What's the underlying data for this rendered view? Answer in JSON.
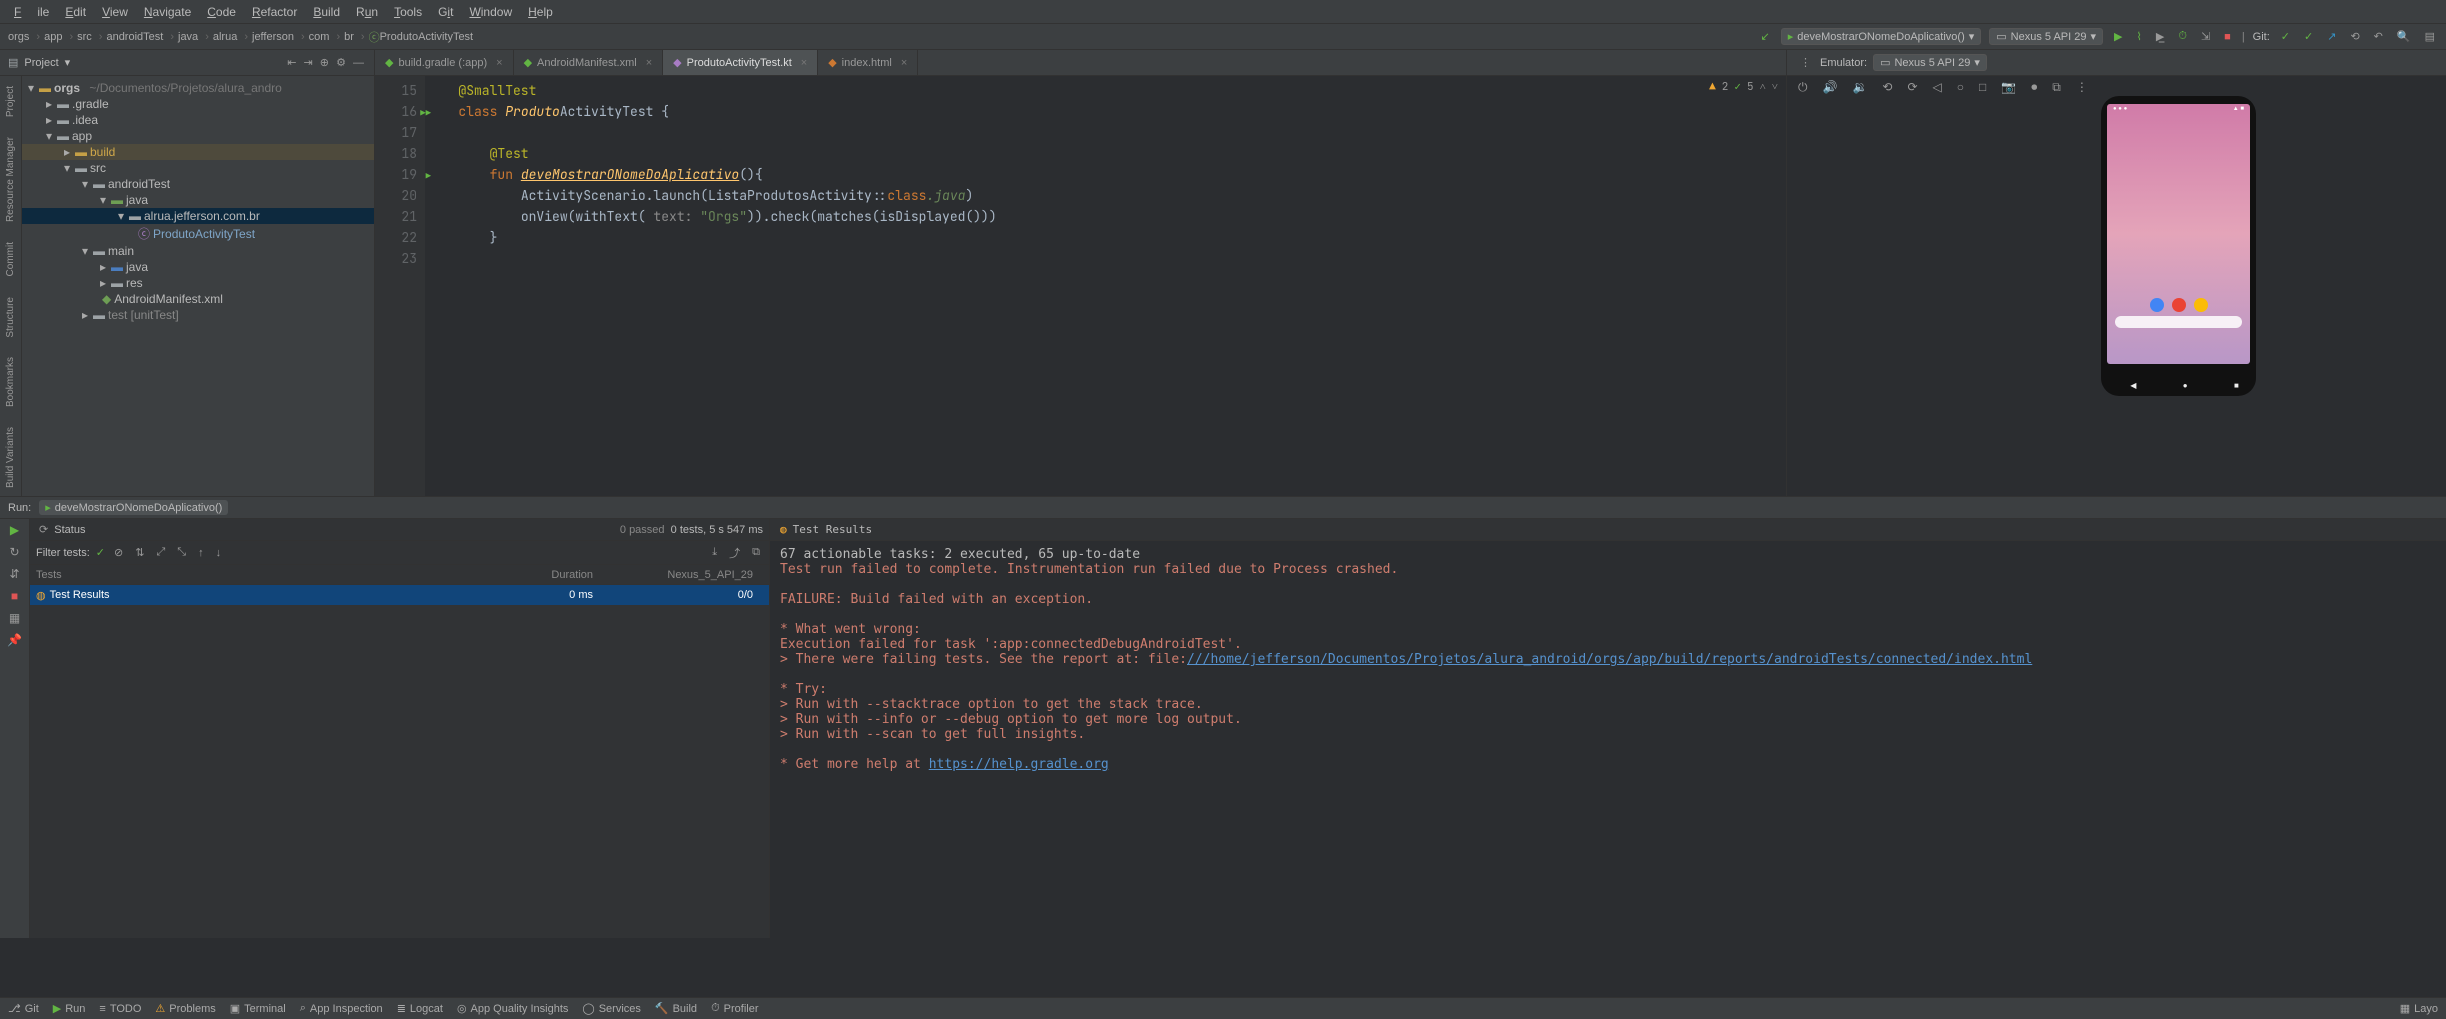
{
  "menu": {
    "file": "File",
    "edit": "Edit",
    "view": "View",
    "navigate": "Navigate",
    "code": "Code",
    "refactor": "Refactor",
    "build": "Build",
    "run": "Run",
    "tools": "Tools",
    "git": "Git",
    "window": "Window",
    "help": "Help"
  },
  "breadcrumbs": [
    "orgs",
    "app",
    "src",
    "androidTest",
    "java",
    "alrua",
    "jefferson",
    "com",
    "br"
  ],
  "breadcrumb_last": "ProdutoActivityTest",
  "toolbar": {
    "run_config": "deveMostrarONomeDoAplicativo()",
    "device": "Nexus 5 API 29",
    "git_label": "Git:"
  },
  "project_header": {
    "label": "Project"
  },
  "editor_tabs": [
    {
      "icon": "gradle",
      "label": "build.gradle (:app)"
    },
    {
      "icon": "xml",
      "label": "AndroidManifest.xml"
    },
    {
      "icon": "kt",
      "label": "ProdutoActivityTest.kt",
      "active": true
    },
    {
      "icon": "html",
      "label": "index.html"
    }
  ],
  "emulator": {
    "label": "Emulator:",
    "device": "Nexus 5 API 29"
  },
  "left_strip": [
    "Project",
    "Resource Manager",
    "Commit",
    "Structure",
    "Bookmarks",
    "Build Variants"
  ],
  "tree": {
    "root": {
      "name": "orgs",
      "path": "~/Documentos/Projetos/alura_andro"
    },
    "gradle": ".gradle",
    "idea": ".idea",
    "app": "app",
    "build": "build",
    "src": "src",
    "androidTest": "androidTest",
    "java1": "java",
    "pkg": "alrua.jefferson.com.br",
    "testfile": "ProdutoActivityTest",
    "main": "main",
    "java2": "java",
    "res": "res",
    "manifest": "AndroidManifest.xml",
    "unitTest": "test [unitTest]"
  },
  "code": {
    "lines": [
      15,
      16,
      17,
      18,
      19,
      20,
      21,
      22,
      23
    ],
    "ann_small": "@SmallTest",
    "kw_class": "class ",
    "cls_name": "Produto",
    "cls_suffix": "ActivityTest {",
    "ann_test": "@Test",
    "kw_fun": "fun ",
    "fn_name": "deveMostrarONomeDoAplicativo",
    "fn_par": "(){",
    "scenario": "ActivityScenario.launch(ListaProdutosActivity::",
    "kw_classref": "class",
    "kw_java": ".java",
    "close_paren": ")",
    "onview": "onView(withText(",
    "text_hint": " text: ",
    "str": "\"Orgs\"",
    "check": ")).check(matches(isDisplayed()))",
    "brace": "}",
    "status": {
      "warn": "2",
      "ok": "5"
    }
  },
  "phone": {
    "time": "",
    "icons": ""
  },
  "run": {
    "title": "Run:",
    "config": "deveMostrarONomeDoAplicativo()",
    "status": "Status",
    "passed": "0 passed",
    "tests": "0 tests, 5 s 547 ms",
    "filter_label": "Filter tests:",
    "cols": {
      "c1": "Tests",
      "c2": "Duration",
      "c3": "Nexus_5_API_29"
    },
    "row": {
      "name": "Test Results",
      "dur": "0 ms",
      "res": "0/0"
    },
    "console_title": "Test Results"
  },
  "console": {
    "l1": "67 actionable tasks: 2 executed, 65 up-to-date",
    "l2": "Test run failed to complete. Instrumentation run failed due to Process crashed.",
    "l3": "FAILURE: Build failed with an exception.",
    "l4": "* What went wrong:",
    "l5": "Execution failed for task ':app:connectedDebugAndroidTest'.",
    "l6": "> There were failing tests. See the report at: file:",
    "l6link": "///home/jefferson/Documentos/Projetos/alura_android/orgs/app/build/reports/androidTests/connected/index.html",
    "l7": "* Try:",
    "l8": "> Run with --stacktrace option to get the stack trace.",
    "l9": "> Run with --info or --debug option to get more log output.",
    "l10": "> Run with --scan to get full insights.",
    "l11": "* Get more help at ",
    "l11link": "https://help.gradle.org"
  },
  "statusbar": {
    "git": "Git",
    "run": "Run",
    "todo": "TODO",
    "problems": "Problems",
    "terminal": "Terminal",
    "inspect": "App Inspection",
    "logcat": "Logcat",
    "insights": "App Quality Insights",
    "services": "Services",
    "build": "Build",
    "profiler": "Profiler",
    "layout": "Layo"
  }
}
